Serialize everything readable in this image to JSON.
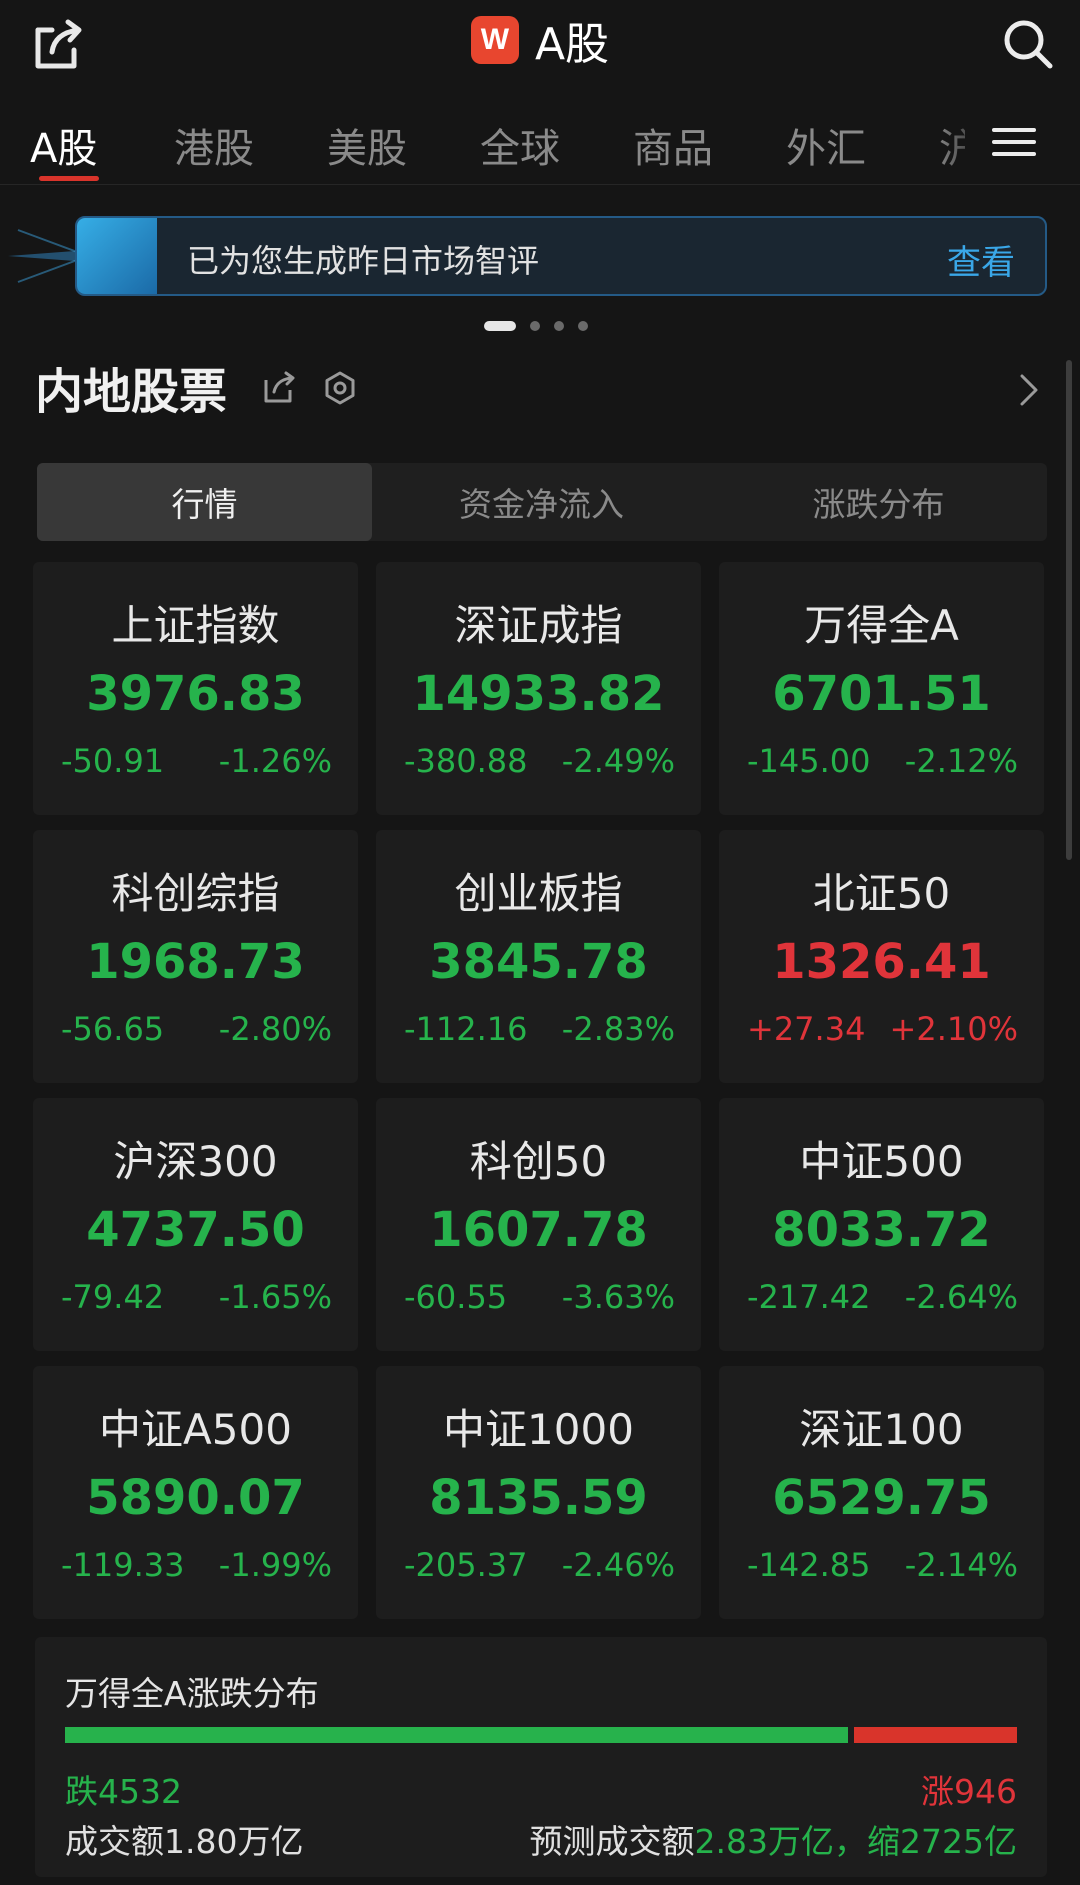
{
  "header": {
    "logo_letter": "W",
    "title": "A股"
  },
  "tabs": [
    {
      "label": "A股",
      "active": true
    },
    {
      "label": "港股"
    },
    {
      "label": "美股"
    },
    {
      "label": "全球"
    },
    {
      "label": "商品"
    },
    {
      "label": "外汇"
    },
    {
      "label": "沪"
    }
  ],
  "banner": {
    "text": "已为您生成昨日市场智评",
    "link": "查看"
  },
  "carousel": {
    "count": 4,
    "active": 0
  },
  "section": {
    "title": "内地股票"
  },
  "segments": [
    {
      "label": "行情",
      "active": true
    },
    {
      "label": "资金净流入"
    },
    {
      "label": "涨跌分布"
    }
  ],
  "indices": [
    {
      "name": "上证指数",
      "value": "3976.83",
      "change": "-50.91",
      "pct": "-1.26%",
      "trend": "down"
    },
    {
      "name": "深证成指",
      "value": "14933.82",
      "change": "-380.88",
      "pct": "-2.49%",
      "trend": "down"
    },
    {
      "name": "万得全A",
      "value": "6701.51",
      "change": "-145.00",
      "pct": "-2.12%",
      "trend": "down"
    },
    {
      "name": "科创综指",
      "value": "1968.73",
      "change": "-56.65",
      "pct": "-2.80%",
      "trend": "down"
    },
    {
      "name": "创业板指",
      "value": "3845.78",
      "change": "-112.16",
      "pct": "-2.83%",
      "trend": "down"
    },
    {
      "name": "北证50",
      "value": "1326.41",
      "change": "+27.34",
      "pct": "+2.10%",
      "trend": "up"
    },
    {
      "name": "沪深300",
      "value": "4737.50",
      "change": "-79.42",
      "pct": "-1.65%",
      "trend": "down"
    },
    {
      "name": "科创50",
      "value": "1607.78",
      "change": "-60.55",
      "pct": "-3.63%",
      "trend": "down"
    },
    {
      "name": "中证500",
      "value": "8033.72",
      "change": "-217.42",
      "pct": "-2.64%",
      "trend": "down"
    },
    {
      "name": "中证A500",
      "value": "5890.07",
      "change": "-119.33",
      "pct": "-1.99%",
      "trend": "down"
    },
    {
      "name": "中证1000",
      "value": "8135.59",
      "change": "-205.37",
      "pct": "-2.46%",
      "trend": "down"
    },
    {
      "name": "深证100",
      "value": "6529.75",
      "change": "-142.85",
      "pct": "-2.14%",
      "trend": "down"
    }
  ],
  "distribution": {
    "title": "万得全A涨跌分布",
    "fall_label": "跌4532",
    "rise_label": "涨946",
    "fall": 4532,
    "rise": 946,
    "turnover": "成交额1.80万亿",
    "forecast_prefix": "预测成交额",
    "forecast_value": "2.83万亿，缩2725亿"
  },
  "colors": {
    "down": "#26b34c",
    "up": "#e0343a",
    "accent": "#d9342b",
    "link": "#3aa7e8"
  }
}
